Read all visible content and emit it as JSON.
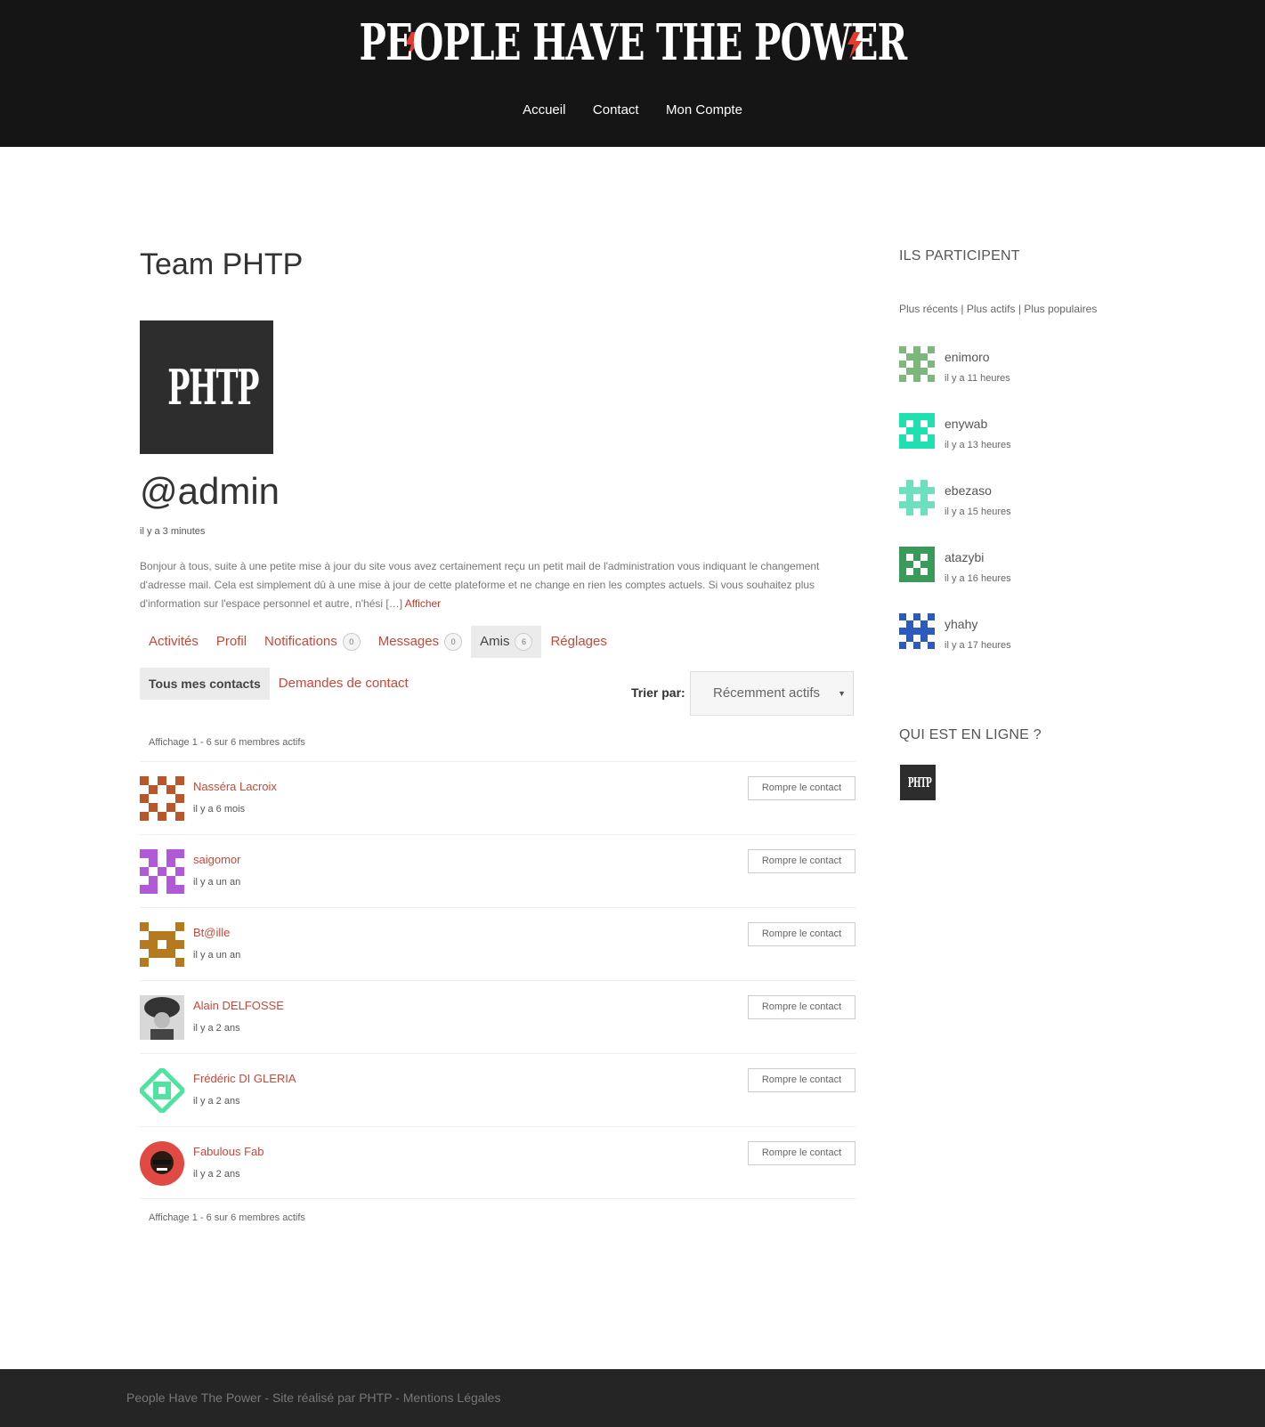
{
  "header": {
    "logo_text": "PEOPLE HAVE THE POWER",
    "nav": [
      "Accueil",
      "Contact",
      "Mon Compte"
    ]
  },
  "main": {
    "page_title": "Team PHTP",
    "avatar_text": "PHTP",
    "username": "@admin",
    "last_active": "il y a 3 minutes",
    "bio": "Bonjour à tous, suite à une petite mise à jour du site vous avez certainement reçu un petit mail de l'administration vous indiquant le changement d'adresse mail. Cela est simplement dû à une mise à jour de cette plateforme et ne change en rien les comptes actuels. Si vous souhaitez plus d'information sur l'espace personnel et autre, n'hési […]",
    "bio_link": "Afficher",
    "tabs": [
      {
        "label": "Activités",
        "count": null,
        "active": false
      },
      {
        "label": "Profil",
        "count": null,
        "active": false
      },
      {
        "label": "Notifications",
        "count": "0",
        "active": false
      },
      {
        "label": "Messages",
        "count": "0",
        "active": false
      },
      {
        "label": "Amis",
        "count": "6",
        "active": true
      },
      {
        "label": "Réglages",
        "count": null,
        "active": false
      }
    ],
    "subtabs": [
      {
        "label": "Tous mes contacts",
        "active": true
      },
      {
        "label": "Demandes de contact",
        "active": false
      }
    ],
    "sort_label": "Trier par:",
    "sort_value": "Récemment actifs",
    "pagination_top": "Affichage 1 - 6 sur 6 membres actifs",
    "pagination_bottom": "Affichage 1 - 6 sur 6 membres actifs",
    "button_label": "Rompre le contact",
    "members": [
      {
        "name": "Nasséra Lacroix",
        "time": "il y a 6 mois",
        "color": "#b9572a",
        "icon": "identicon"
      },
      {
        "name": "saigomor",
        "time": "il y a un an",
        "color": "#b05ad8",
        "icon": "identicon"
      },
      {
        "name": "Bt@ille",
        "time": "il y a un an",
        "color": "#b57a1f",
        "icon": "identicon"
      },
      {
        "name": "Alain DELFOSSE",
        "time": "il y a 2 ans",
        "color": "#555555",
        "icon": "photo"
      },
      {
        "name": "Frédéric DI GLERIA",
        "time": "il y a 2 ans",
        "color": "#4fe3a0",
        "icon": "identicon"
      },
      {
        "name": "Fabulous Fab",
        "time": "il y a 2 ans",
        "color": "#e04a43",
        "icon": "cartoon"
      }
    ]
  },
  "sidebar": {
    "participants_title": "ILS PARTICIPENT",
    "filter_links": "Plus récents | Plus actifs | Plus populaires",
    "participants": [
      {
        "name": "enimoro",
        "time": "il y a 11 heures",
        "color": "#7cb87c"
      },
      {
        "name": "enywab",
        "time": "il y a 13 heures",
        "color": "#1fe0b0"
      },
      {
        "name": "ebezaso",
        "time": "il y a 15 heures",
        "color": "#6de0c0"
      },
      {
        "name": "atazybi",
        "time": "il y a 16 heures",
        "color": "#3a9a5a"
      },
      {
        "name": "yhahy",
        "time": "il y a 17 heures",
        "color": "#2a5bbd"
      }
    ],
    "online_title": "QUI EST EN LIGNE ?",
    "online_avatar_text": "PHTP"
  },
  "footer": {
    "text": "People Have The Power - Site réalisé par PHTP - Mentions Légales"
  },
  "colors": {
    "accent": "#c8473a",
    "bolt": "#e63a2e",
    "header_bg": "#151515",
    "footer_bg": "#252525"
  }
}
